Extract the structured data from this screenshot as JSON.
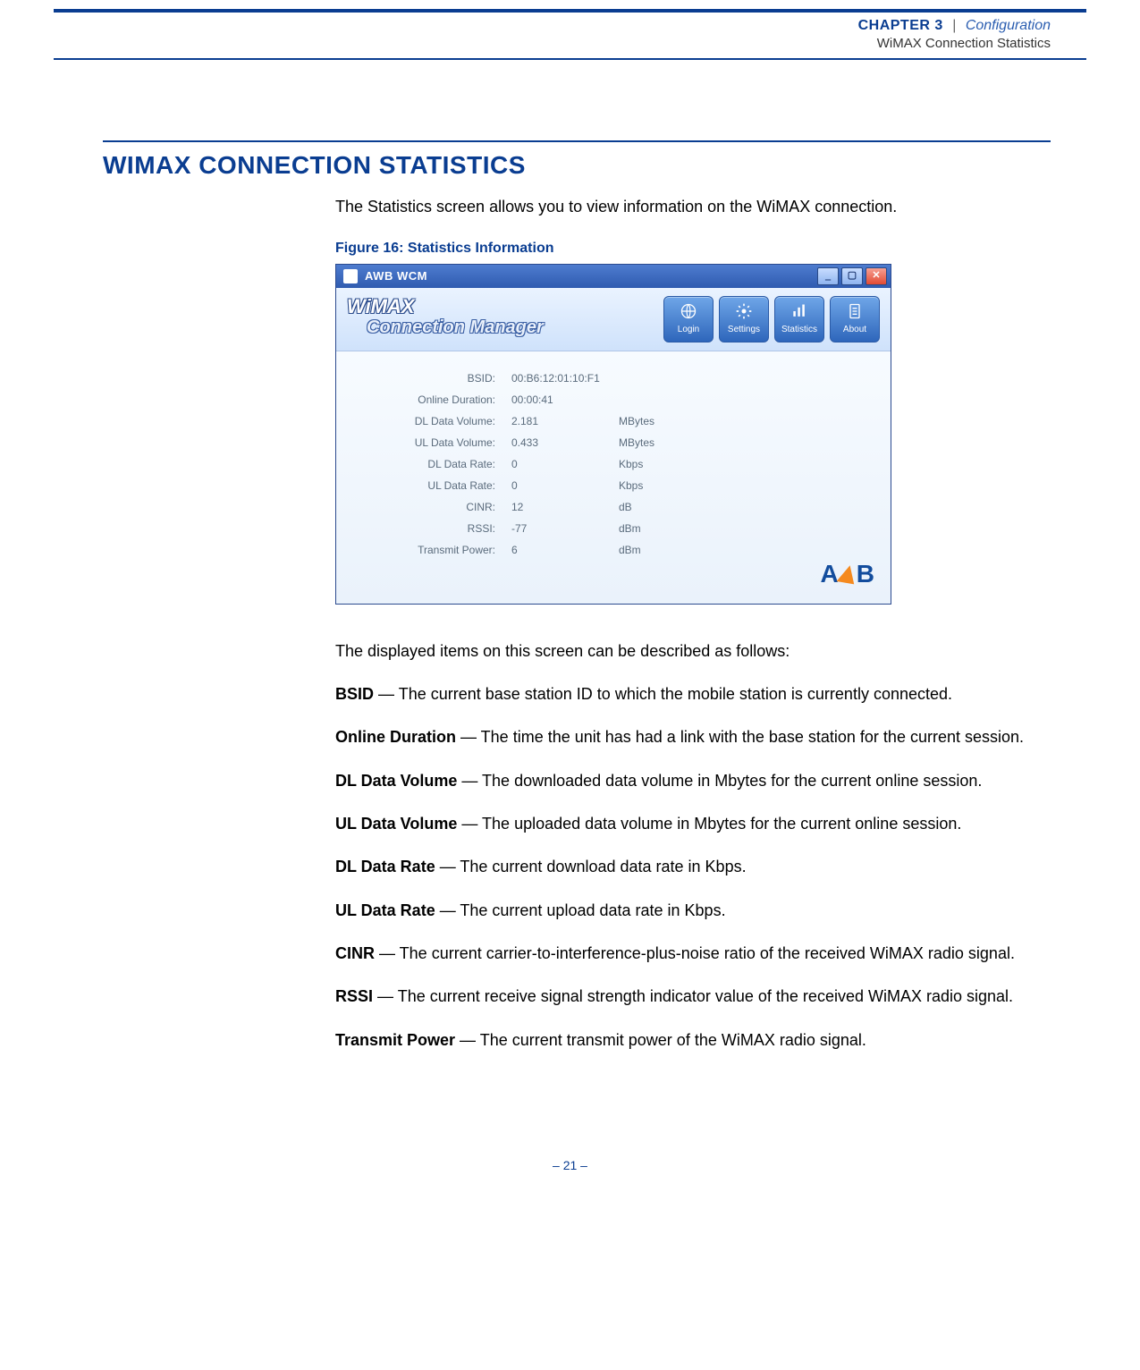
{
  "header": {
    "chapter_label": "CHAPTER 3",
    "separator": "|",
    "trail": "Configuration",
    "subtitle": "WiMAX Connection Statistics"
  },
  "section_title": "WIMAX CONNECTION STATISTICS",
  "intro": "The Statistics screen allows you to view information on the WiMAX connection.",
  "figure_caption": "Figure 16:  Statistics Information",
  "window": {
    "title": "AWB WCM",
    "brand_line1": "WiMAX",
    "brand_line2": "Connection Manager",
    "nav": [
      "Login",
      "Settings",
      "Statistics",
      "About"
    ],
    "logo": {
      "a": "A",
      "b": "B"
    }
  },
  "stats": [
    {
      "label": "BSID:",
      "value": "00:B6:12:01:10:F1",
      "unit": ""
    },
    {
      "label": "Online Duration:",
      "value": "00:00:41",
      "unit": ""
    },
    {
      "label": "DL Data Volume:",
      "value": "2.181",
      "unit": "MBytes"
    },
    {
      "label": "UL Data Volume:",
      "value": "0.433",
      "unit": "MBytes"
    },
    {
      "label": "DL Data Rate:",
      "value": "0",
      "unit": "Kbps"
    },
    {
      "label": "UL Data Rate:",
      "value": "0",
      "unit": "Kbps"
    },
    {
      "label": "CINR:",
      "value": "12",
      "unit": "dB"
    },
    {
      "label": "RSSI:",
      "value": "-77",
      "unit": "dBm"
    },
    {
      "label": "Transmit Power:",
      "value": "6",
      "unit": "dBm"
    }
  ],
  "desc_intro": "The displayed items on this screen can be described as follows:",
  "definitions": [
    {
      "term": "BSID",
      "text": " — The current base station ID to which the mobile station is currently connected."
    },
    {
      "term": "Online Duration",
      "text": " — The time the unit has had a link with the base station for the current session."
    },
    {
      "term": "DL Data Volume",
      "text": " — The downloaded data volume in Mbytes for the current online session."
    },
    {
      "term": "UL Data Volume",
      "text": " — The uploaded data volume in Mbytes for the current online session."
    },
    {
      "term": "DL Data Rate",
      "text": " — The current download data rate in Kbps."
    },
    {
      "term": "UL Data Rate",
      "text": " — The current upload data rate in Kbps."
    },
    {
      "term": "CINR",
      "text": " — The current carrier-to-interference-plus-noise ratio of the received WiMAX radio signal."
    },
    {
      "term": "RSSI",
      "text": " — The current receive signal strength indicator value of the received WiMAX radio signal."
    },
    {
      "term": "Transmit Power",
      "text": " — The current transmit power of the WiMAX radio signal."
    }
  ],
  "footer": "–  21  –"
}
